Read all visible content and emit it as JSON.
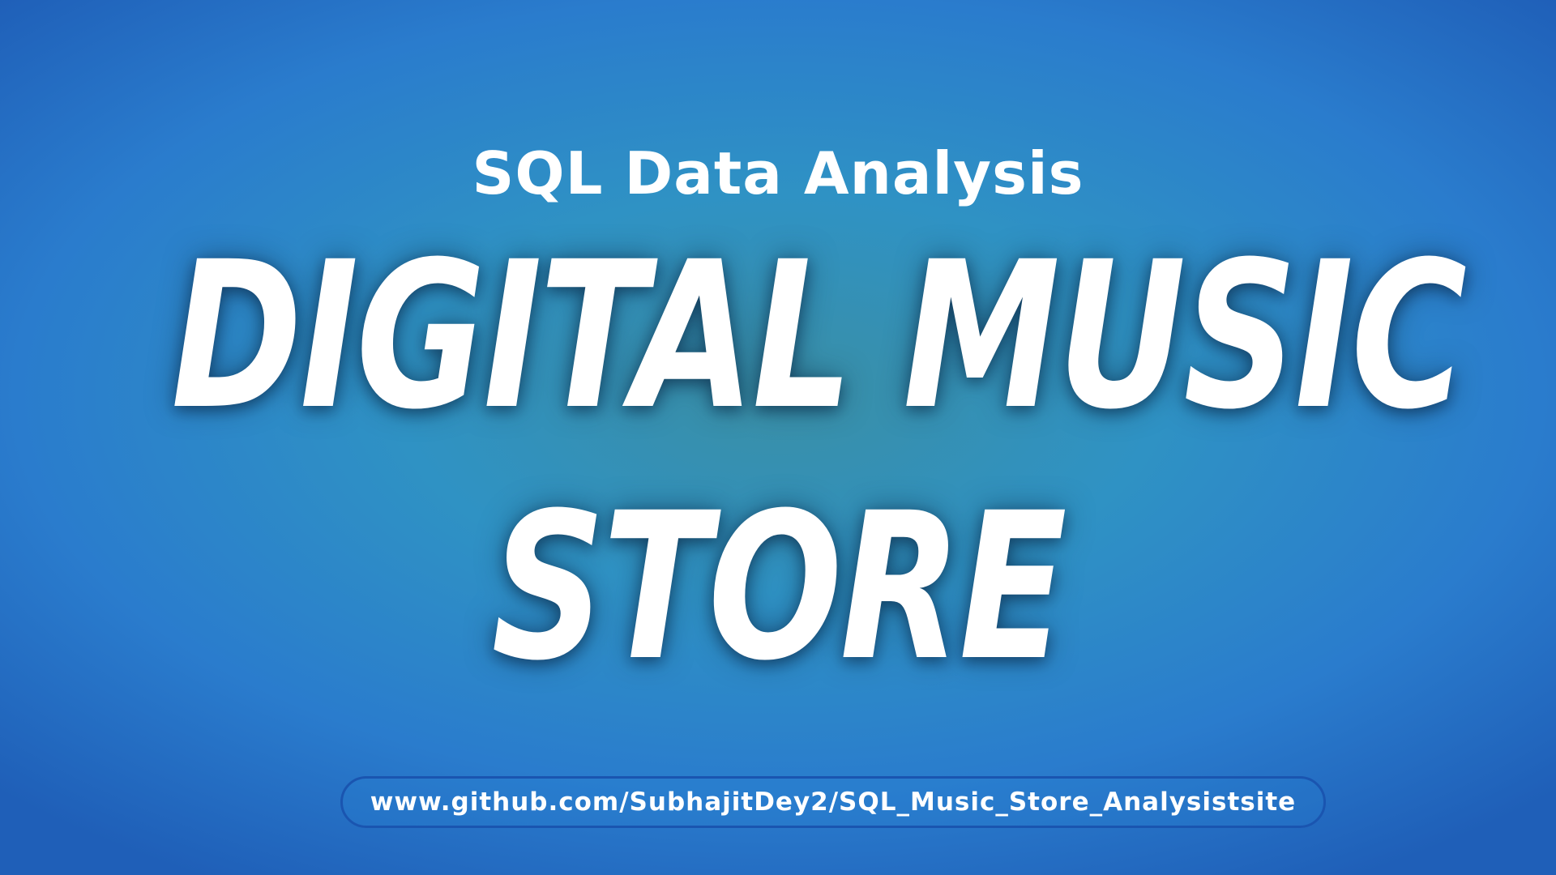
{
  "banner": {
    "subtitle": "SQL Data Analysis",
    "title_line1": "DIGITAL MUSIC",
    "title_line2": "STORE",
    "url": "www.github.com/SubhajitDey2/SQL_Music_Store_Analysistsite"
  },
  "colors": {
    "background_center": "#3a8fa6",
    "background_edge": "#1f5fb8",
    "text": "#ffffff",
    "pill_border": "#1a55b0"
  }
}
